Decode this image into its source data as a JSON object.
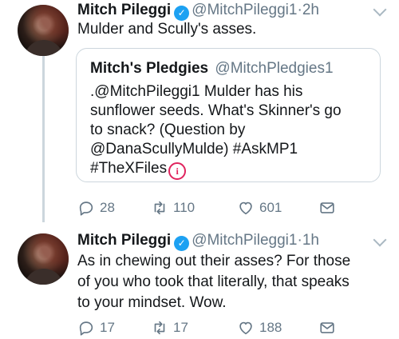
{
  "tweets": [
    {
      "author": {
        "name": "Mitch Pileggi",
        "handle": "@MitchPileggi1",
        "verified": true
      },
      "time": "2h",
      "text": "Mulder and Scully's asses.",
      "quoted": {
        "author": {
          "name": "Mitch's Pledgies",
          "handle": "@MitchPledgies1"
        },
        "lines": [
          ".@MitchPileggi1 Mulder has his",
          "sunflower seeds. What's Skinner's go",
          "to snack? (Question by",
          "@DanaScullyMulde) #AskMP1",
          "#TheXFiles"
        ]
      },
      "actions": {
        "replies": "28",
        "retweets": "110",
        "likes": "601"
      }
    },
    {
      "author": {
        "name": "Mitch Pileggi",
        "handle": "@MitchPileggi1",
        "verified": true
      },
      "time": "1h",
      "lines": [
        "As in chewing out their asses?  For those",
        "of you who took that literally, that speaks",
        "to your mindset.  Wow."
      ],
      "actions": {
        "replies": "17",
        "retweets": "17",
        "likes": "188"
      }
    }
  ],
  "separator": "·",
  "icons": {
    "verified": "verified-badge-icon",
    "reply": "reply-icon",
    "retweet": "retweet-icon",
    "like": "heart-icon",
    "dm": "envelope-icon",
    "menu": "chevron-down-icon",
    "info": "info-icon"
  },
  "colors": {
    "accent": "#1da1f2",
    "muted": "#657786",
    "border": "#ccd6dd",
    "alert": "#e0245e"
  }
}
